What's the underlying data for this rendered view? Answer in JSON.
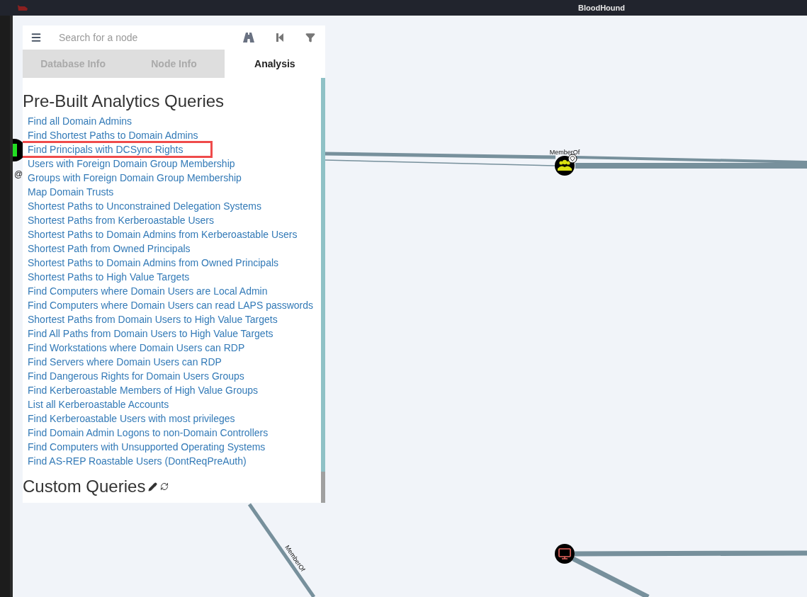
{
  "window": {
    "title": "BloodHound"
  },
  "search": {
    "placeholder": "Search for a node"
  },
  "tabs": [
    {
      "label": "Database Info",
      "selected": false
    },
    {
      "label": "Node Info",
      "selected": false
    },
    {
      "label": "Analysis",
      "selected": true
    }
  ],
  "analysis": {
    "heading": "Pre-Built Analytics Queries",
    "queries": [
      {
        "label": "Find all Domain Admins",
        "highlighted": false
      },
      {
        "label": "Find Shortest Paths to Domain Admins",
        "highlighted": false
      },
      {
        "label": "Find Principals with DCSync Rights",
        "highlighted": true
      },
      {
        "label": "Users with Foreign Domain Group Membership",
        "highlighted": false
      },
      {
        "label": "Groups with Foreign Domain Group Membership",
        "highlighted": false
      },
      {
        "label": "Map Domain Trusts",
        "highlighted": false
      },
      {
        "label": "Shortest Paths to Unconstrained Delegation Systems",
        "highlighted": false
      },
      {
        "label": "Shortest Paths from Kerberoastable Users",
        "highlighted": false
      },
      {
        "label": "Shortest Paths to Domain Admins from Kerberoastable Users",
        "highlighted": false
      },
      {
        "label": "Shortest Path from Owned Principals",
        "highlighted": false
      },
      {
        "label": "Shortest Paths to Domain Admins from Owned Principals",
        "highlighted": false
      },
      {
        "label": "Shortest Paths to High Value Targets",
        "highlighted": false
      },
      {
        "label": "Find Computers where Domain Users are Local Admin",
        "highlighted": false
      },
      {
        "label": "Find Computers where Domain Users can read LAPS passwords",
        "highlighted": false
      },
      {
        "label": "Shortest Paths from Domain Users to High Value Targets",
        "highlighted": false
      },
      {
        "label": "Find All Paths from Domain Users to High Value Targets",
        "highlighted": false
      },
      {
        "label": "Find Workstations where Domain Users can RDP",
        "highlighted": false
      },
      {
        "label": "Find Servers where Domain Users can RDP",
        "highlighted": false
      },
      {
        "label": "Find Dangerous Rights for Domain Users Groups",
        "highlighted": false
      },
      {
        "label": "Find Kerberoastable Members of High Value Groups",
        "highlighted": false
      },
      {
        "label": "List all Kerberoastable Accounts",
        "highlighted": false
      },
      {
        "label": "Find Kerberoastable Users with most privileges",
        "highlighted": false
      },
      {
        "label": "Find Domain Admin Logons to non-Domain Controllers",
        "highlighted": false
      },
      {
        "label": "Find Computers with Unsupported Operating Systems",
        "highlighted": false
      },
      {
        "label": "Find AS-REP Roastable Users (DontReqPreAuth)",
        "highlighted": false
      }
    ],
    "custom_heading": "Custom Queries"
  },
  "graph": {
    "edge_labels": [
      "MemberOf",
      "MemberOf"
    ],
    "nodes": [
      {
        "kind": "user",
        "label": "@"
      },
      {
        "kind": "group",
        "high_value": true
      },
      {
        "kind": "computer"
      }
    ]
  }
}
